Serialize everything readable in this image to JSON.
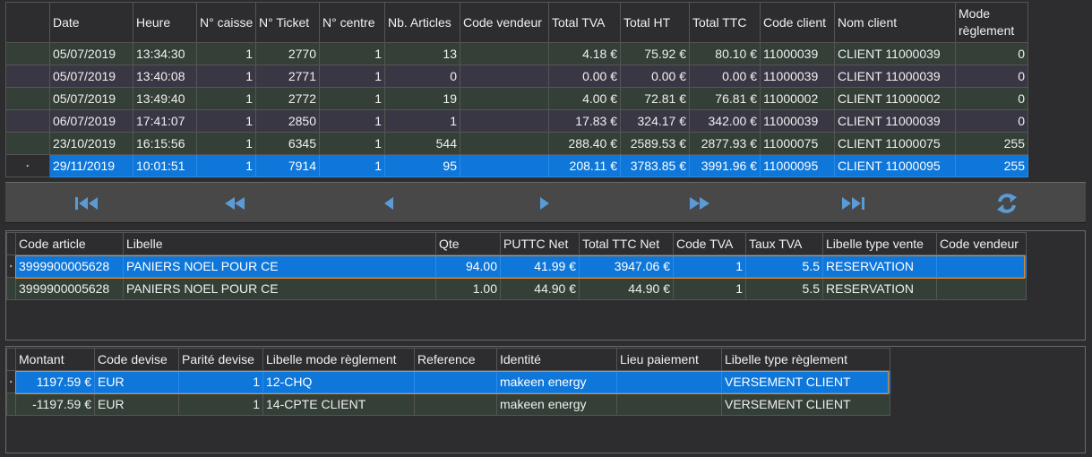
{
  "tickets": {
    "columns": [
      "Date",
      "Heure",
      "N° caisse",
      "N° Ticket",
      "N° centre",
      "Nb. Articles",
      "Code vendeur",
      "Total TVA",
      "Total HT",
      "Total TTC",
      "Code client",
      "Nom client",
      "Mode règlement"
    ],
    "rows": [
      [
        "05/07/2019",
        "13:34:30",
        "1",
        "2770",
        "1",
        "13",
        "",
        "4.18 €",
        "75.92 €",
        "80.10 €",
        "11000039",
        "CLIENT  11000039",
        "0"
      ],
      [
        "05/07/2019",
        "13:40:08",
        "1",
        "2771",
        "1",
        "0",
        "",
        "0.00 €",
        "0.00 €",
        "0.00 €",
        "11000039",
        "CLIENT  11000039",
        "0"
      ],
      [
        "05/07/2019",
        "13:49:40",
        "1",
        "2772",
        "1",
        "19",
        "",
        "4.00 €",
        "72.81 €",
        "76.81 €",
        "11000002",
        "CLIENT  11000002",
        "0"
      ],
      [
        "06/07/2019",
        "17:41:07",
        "1",
        "2850",
        "1",
        "1",
        "",
        "17.83 €",
        "324.17 €",
        "342.00 €",
        "11000039",
        "CLIENT  11000039",
        "0"
      ],
      [
        "23/10/2019",
        "16:15:56",
        "1",
        "6345",
        "1",
        "544",
        "",
        "288.40 €",
        "2589.53 €",
        "2877.93 €",
        "11000075",
        "CLIENT  11000075",
        "255"
      ],
      [
        "29/11/2019",
        "10:01:51",
        "1",
        "7914",
        "1",
        "95",
        "",
        "208.11 €",
        "3783.85 €",
        "3991.96 €",
        "11000095",
        "CLIENT  11000095",
        "255"
      ]
    ],
    "row_indicator": "‣"
  },
  "navigator": {
    "buttons": [
      {
        "icon": "first-record-icon"
      },
      {
        "icon": "previous-page-icon"
      },
      {
        "icon": "previous-record-icon"
      },
      {
        "icon": "next-record-icon"
      },
      {
        "icon": "next-page-icon"
      },
      {
        "icon": "last-record-icon"
      },
      {
        "icon": "refresh-icon"
      }
    ],
    "icon_color": "#5b9bd5"
  },
  "articles": {
    "columns": [
      "Code article",
      "Libelle",
      "Qte",
      "PUTTC Net",
      "Total TTC Net",
      "Code TVA",
      "Taux TVA",
      "Libelle type vente",
      "Code vendeur"
    ],
    "rows": [
      [
        "3999900005628",
        "PANIERS NOEL POUR CE",
        "94.00",
        "41.99 €",
        "3947.06 €",
        "1",
        "5.5",
        "RESERVATION",
        ""
      ],
      [
        "3999900005628",
        "PANIERS NOEL POUR CE",
        "1.00",
        "44.90 €",
        "44.90 €",
        "1",
        "5.5",
        "RESERVATION",
        ""
      ]
    ],
    "row_indicator": "‣"
  },
  "payments": {
    "columns": [
      "Montant",
      "Code devise",
      "Parité devise",
      "Libelle mode règlement",
      "Reference",
      "Identité",
      "Lieu paiement",
      "Libelle type règlement"
    ],
    "rows": [
      [
        "1197.59 €",
        "EUR",
        "1",
        "12-CHQ",
        "",
        "makeen energy",
        "",
        "VERSEMENT CLIENT"
      ],
      [
        "-1197.59 €",
        "EUR",
        "1",
        "14-CPTE CLIENT",
        "",
        "makeen energy",
        "",
        "VERSEMENT CLIENT"
      ]
    ],
    "row_indicator": "‣"
  },
  "colors": {
    "selection": "#0f77d9",
    "row_green": "#333f37",
    "row_purple": "#3a3744",
    "background": "#2d2d30",
    "selection_border": "#e88a2a"
  }
}
